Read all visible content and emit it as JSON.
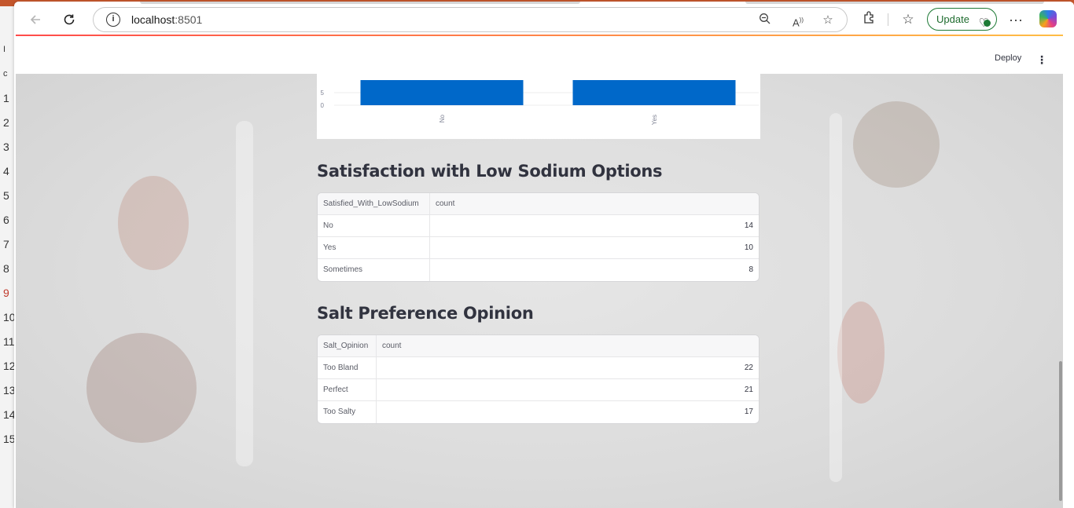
{
  "browser": {
    "url_host": "localhost",
    "url_port": ":8501",
    "update_label": "Update"
  },
  "editor": {
    "line_numbers": [
      "1",
      "2",
      "3",
      "4",
      "5",
      "6",
      "7",
      "8",
      "9",
      "10",
      "11",
      "12",
      "13",
      "14",
      "15"
    ]
  },
  "app": {
    "deploy_label": "Deploy"
  },
  "chart_data": {
    "type": "bar",
    "categories": [
      "No",
      "Yes"
    ],
    "values": [
      10,
      10
    ],
    "y_ticks": [
      "0",
      "5"
    ],
    "color": "#0068c9"
  },
  "sections": [
    {
      "title": "Satisfaction with Low Sodium Options",
      "columns": [
        "Satisfied_With_LowSodium",
        "count"
      ],
      "rows": [
        [
          "No",
          "14"
        ],
        [
          "Yes",
          "10"
        ],
        [
          "Sometimes",
          "8"
        ]
      ]
    },
    {
      "title": "Salt Preference Opinion",
      "columns": [
        "Salt_Opinion",
        "count"
      ],
      "rows": [
        [
          "Too Bland",
          "22"
        ],
        [
          "Perfect",
          "21"
        ],
        [
          "Too Salty",
          "17"
        ]
      ]
    }
  ]
}
